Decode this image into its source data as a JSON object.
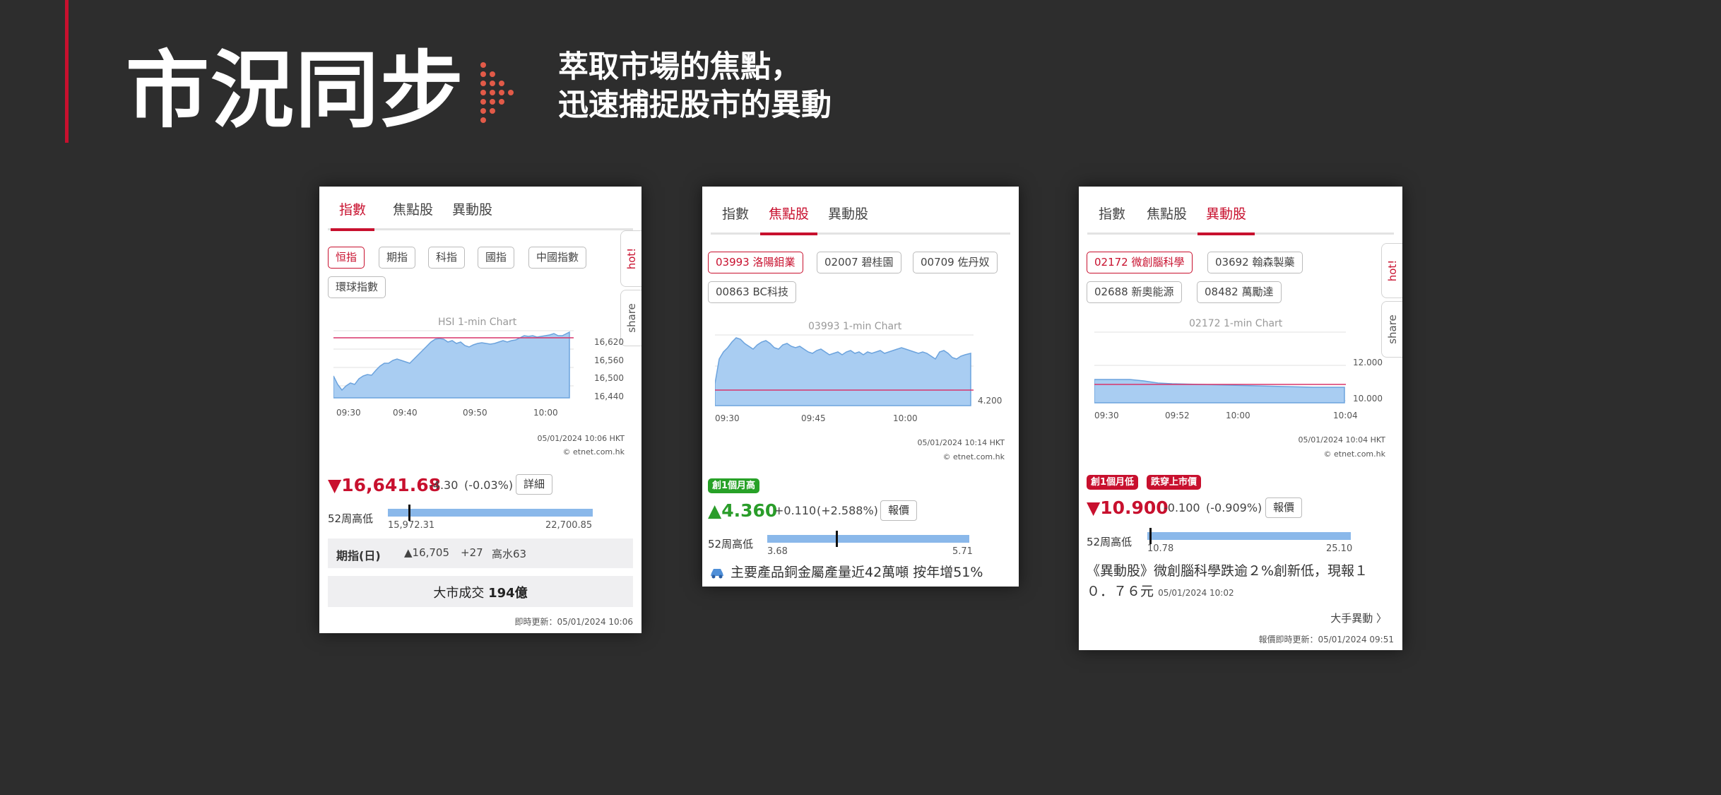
{
  "slide": {
    "headline": "市況同步",
    "tagline_line1": "萃取市場的焦點，",
    "tagline_line2": "迅速捕捉股市的異動",
    "accent": "#c8102e"
  },
  "panels": {
    "index": {
      "tabs": [
        "指數",
        "焦點股",
        "異動股"
      ],
      "active_tab": "指數",
      "chips": [
        "恒指",
        "期指",
        "科指",
        "國指",
        "中國指數",
        "環球指數"
      ],
      "side_hot": "hot!",
      "side_share": "share",
      "chart": {
        "title": "HSI   1-min Chart",
        "y_ticks": [
          "16,620",
          "16,560",
          "16,500",
          "16,440"
        ],
        "x_ticks": [
          "09:30",
          "09:40",
          "09:50",
          "10:00"
        ],
        "timestamp": "05/01/2024 10:06 HKT",
        "source": "© etnet.com.hk"
      },
      "price": "▼16,641.68",
      "change": "-4.30",
      "change_pct": "(-0.03%)",
      "detail_btn": "詳細",
      "week52_label": "52周高低",
      "week52_low": "15,972.31",
      "week52_high": "22,700.85",
      "week52_position": 0.1,
      "futures_label": "期指(日)",
      "futures_price": "▲16,705",
      "futures_change": "+27",
      "futures_discount": "高水63",
      "turnover_prefix": "大市成交",
      "turnover_value": "194億",
      "update": "即時更新：05/01/2024 10:06"
    },
    "focus": {
      "tabs": [
        "指數",
        "焦點股",
        "異動股"
      ],
      "active_tab": "焦點股",
      "chips": [
        "03993 洛陽鉬業",
        "02007 碧桂園",
        "00709 佐丹奴",
        "00863 BC科技"
      ],
      "chart": {
        "title": "03993   1-min Chart",
        "y_ticks": [
          "4.200"
        ],
        "x_ticks": [
          "09:30",
          "09:45",
          "10:00"
        ],
        "timestamp": "05/01/2024 10:14 HKT",
        "source": "© etnet.com.hk"
      },
      "badge": "創1個月高",
      "price": "▲4.360",
      "change": "+0.110",
      "change_pct": "(+2.588%)",
      "quote_btn": "報價",
      "week52_label": "52周高低",
      "week52_low": "3.68",
      "week52_high": "5.71",
      "week52_position": 0.34,
      "news_icon": "car-icon",
      "news": "主要產品銅金屬產量近42萬噸 按年增51%"
    },
    "movers": {
      "tabs": [
        "指數",
        "焦點股",
        "異動股"
      ],
      "active_tab": "異動股",
      "chips": [
        "02172 微創腦科學",
        "03692 翰森製藥",
        "02688 新奧能源",
        "08482 萬勵達"
      ],
      "side_hot": "hot!",
      "side_share": "share",
      "chart": {
        "title": "02172   1-min Chart",
        "y_ticks": [
          "12.000",
          "10.000"
        ],
        "x_ticks": [
          "09:30",
          "09:52",
          "10:00",
          "10:04"
        ],
        "timestamp": "05/01/2024 10:04 HKT",
        "source": "© etnet.com.hk"
      },
      "badge1": "創1個月低",
      "badge2": "跌穿上市價",
      "price": "▼10.900",
      "change": "-0.100",
      "change_pct": "(-0.909%)",
      "quote_btn": "報價",
      "week52_label": "52周高低",
      "week52_low": "10.78",
      "week52_high": "25.10",
      "week52_position": 0.01,
      "news": "《異動股》微創腦科學跌逾２%創新低，現報１０．７６元",
      "news_time": "05/01/2024 10:02",
      "big_move": "大手異動 〉",
      "update": "報價即時更新：05/01/2024 09:51"
    }
  }
}
